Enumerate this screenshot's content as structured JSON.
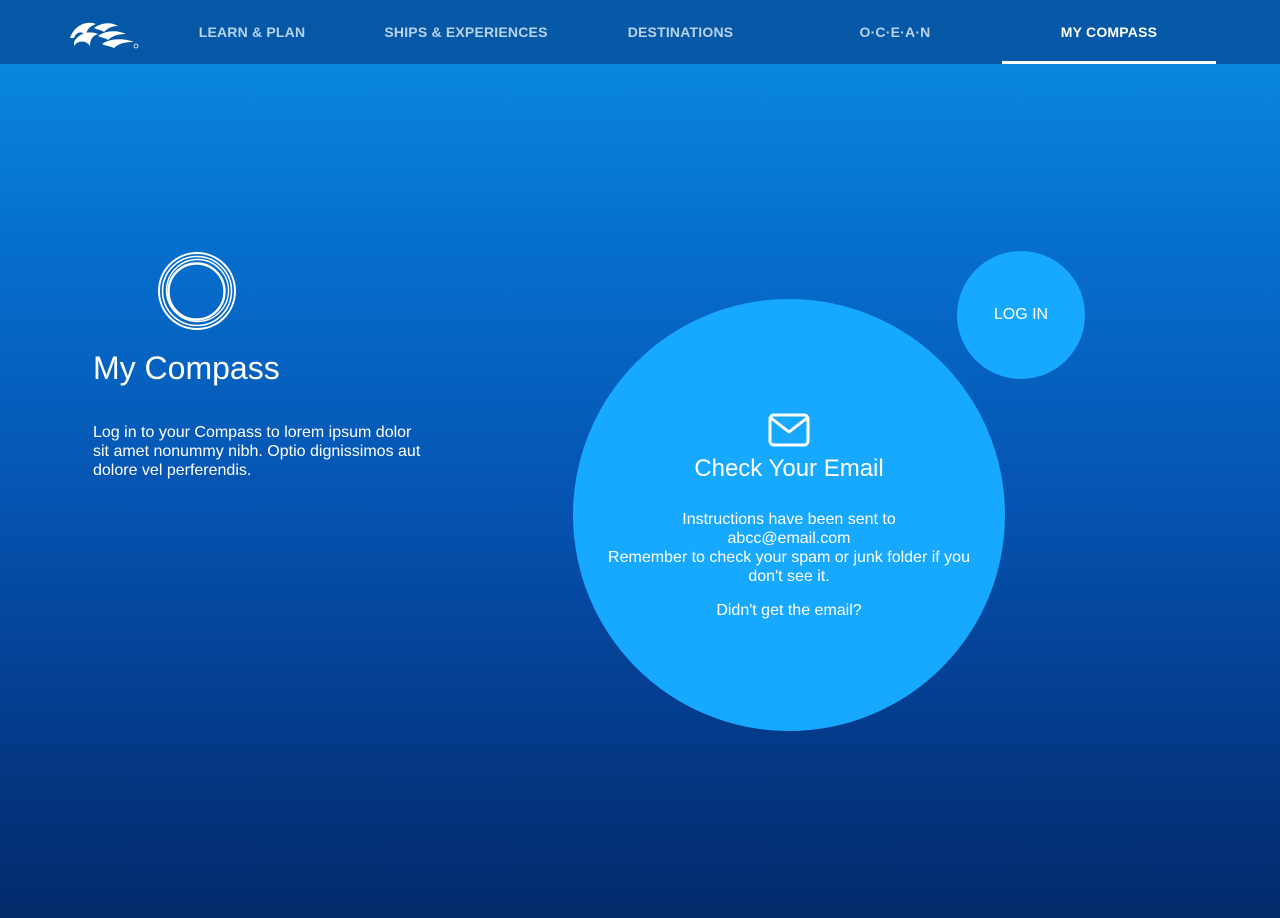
{
  "nav": {
    "logo_icon": "princess-seawitch-logo-icon",
    "items": [
      {
        "label": "LEARN & PLAN"
      },
      {
        "label": "SHIPS & EXPERIENCES"
      },
      {
        "label": "DESTINATIONS"
      },
      {
        "label": "O·C·E·A·N"
      },
      {
        "label": "MY COMPASS"
      }
    ],
    "active_index": 4
  },
  "hero": {
    "icon": "compass-ring-icon",
    "title": "My Compass",
    "description": "Log in to your Compass to lorem ipsum dolor sit amet nonummy nibh. Optio dignissimos aut dolore vel perferendis."
  },
  "email_bubble": {
    "icon": "envelope-icon",
    "title": "Check Your Email",
    "line1": "Instructions have been sent to",
    "email": "abcc@email.com",
    "line2": "Remember to check your spam or junk folder if you don't see it.",
    "resend_link": "Didn't get the email?"
  },
  "login_bubble": {
    "label": "LOG IN"
  },
  "colors": {
    "nav_bg": "#0558a6",
    "bubble": "#17a8ff",
    "text": "#ffffff"
  }
}
